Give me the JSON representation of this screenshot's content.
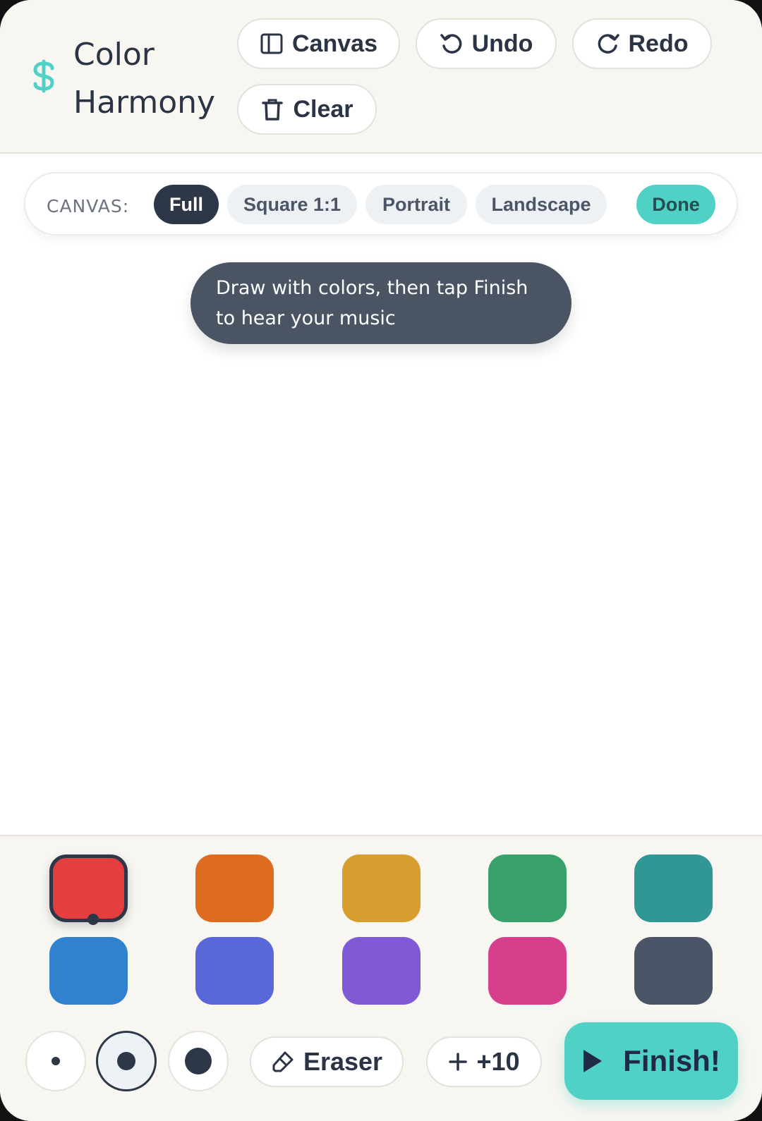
{
  "app": {
    "title_line1": "Color",
    "title_line2": "Harmony",
    "logo_icon": "dollar-icon",
    "accent_color": "#4fd1c5"
  },
  "header": {
    "canvas_label": "Canvas",
    "undo_label": "Undo",
    "redo_label": "Redo",
    "clear_label": "Clear"
  },
  "canvas_size": {
    "label": "CANVAS:",
    "options": [
      "Full",
      "Square 1:1",
      "Portrait",
      "Landscape"
    ],
    "selected": "Full",
    "done_label": "Done"
  },
  "hint": {
    "text": "Draw with colors, then tap Finish to hear your music"
  },
  "palette": {
    "colors": [
      "#e53e3e",
      "#dd6b20",
      "#d69e2e",
      "#38a169",
      "#319795",
      "#3182ce",
      "#5a67d8",
      "#805ad5",
      "#d53f8c",
      "#4a5568"
    ],
    "selected_index": 0
  },
  "tools": {
    "brush_sizes": [
      "small",
      "medium",
      "large"
    ],
    "selected_brush": "medium",
    "eraser_label": "Eraser",
    "plus_label": "+10",
    "finish_label": "Finish!"
  }
}
